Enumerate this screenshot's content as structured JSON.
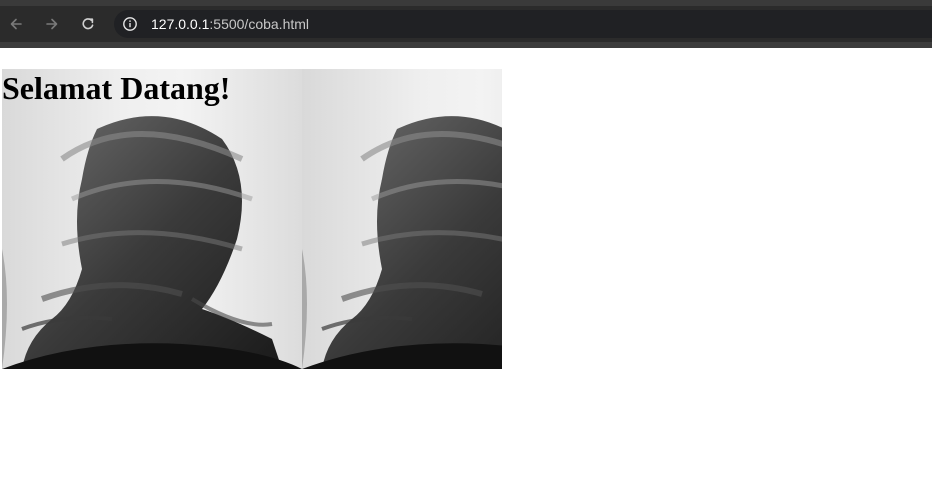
{
  "browser": {
    "url_host": "127.0.0.1",
    "url_rest": ":5500/coba.html",
    "icons": {
      "back": "back-arrow-icon",
      "forward": "forward-arrow-icon",
      "reload": "reload-icon",
      "site_info": "info-icon"
    }
  },
  "page": {
    "heading": "Selamat Datang!",
    "images": [
      {
        "name": "background-photo-1",
        "alt": ""
      },
      {
        "name": "background-photo-2",
        "alt": ""
      }
    ]
  },
  "colors": {
    "chrome_bg": "#2b2b2b",
    "omnibox_bg": "#202124",
    "page_bg": "#ffffff",
    "heading_text": "#000000"
  }
}
